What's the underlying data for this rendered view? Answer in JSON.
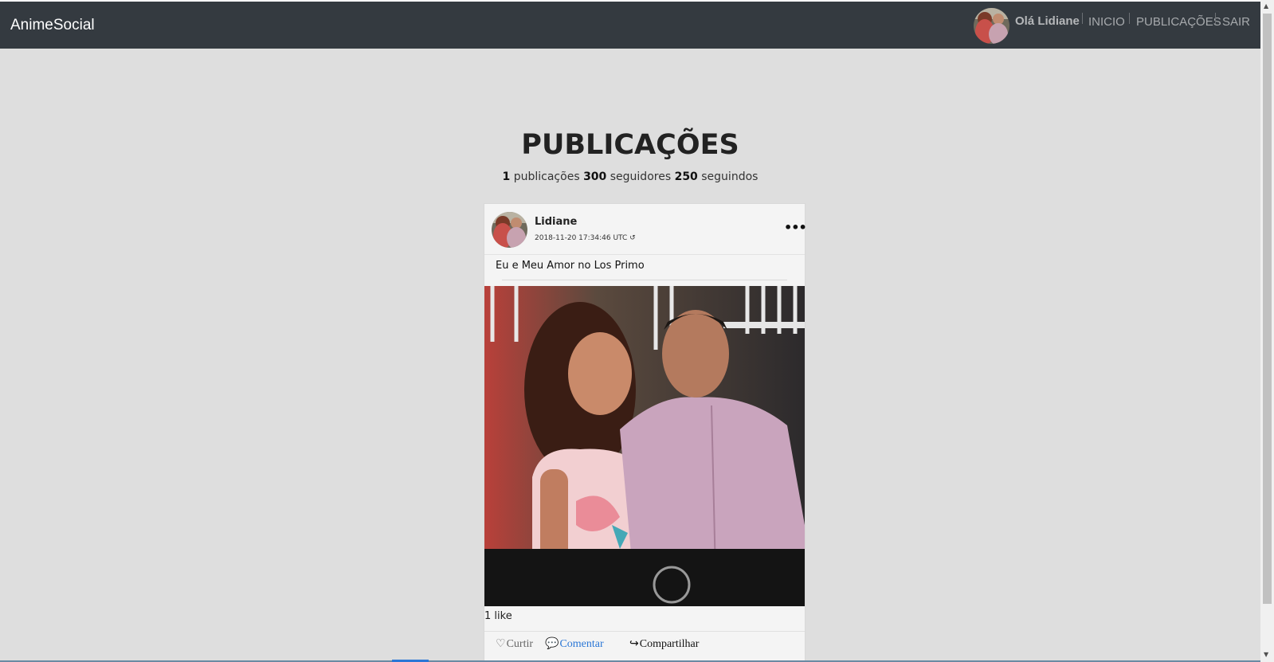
{
  "navbar": {
    "brand": "AnimeSocial",
    "greeting": "Olá Lidiane",
    "links": [
      "INICIO",
      "PUBLICAÇÕES",
      "SAIR"
    ]
  },
  "page": {
    "title": "PUBLICAÇÕES",
    "stats": {
      "posts_count": "1",
      "posts_label": "publicações",
      "followers_count": "300",
      "followers_label": "seguidores",
      "following_count": "250",
      "following_label": "seguindos"
    }
  },
  "post": {
    "author": "Lidiane",
    "timestamp": "2018-11-20 17:34:46 UTC",
    "caption": "Eu e Meu Amor no Los Primo",
    "likes": "1 like",
    "actions": {
      "like": "Curtir",
      "comment": "Comentar",
      "share": "Compartilhar"
    }
  },
  "icons": [
    "user-avatar",
    "history-icon",
    "more-options-icon",
    "heart-icon",
    "comment-icon",
    "share-icon"
  ],
  "colors": {
    "navbar_bg": "#343a40",
    "page_bg": "#dedede",
    "card_bg": "#f4f4f4",
    "link_blue": "#2b77d6"
  }
}
